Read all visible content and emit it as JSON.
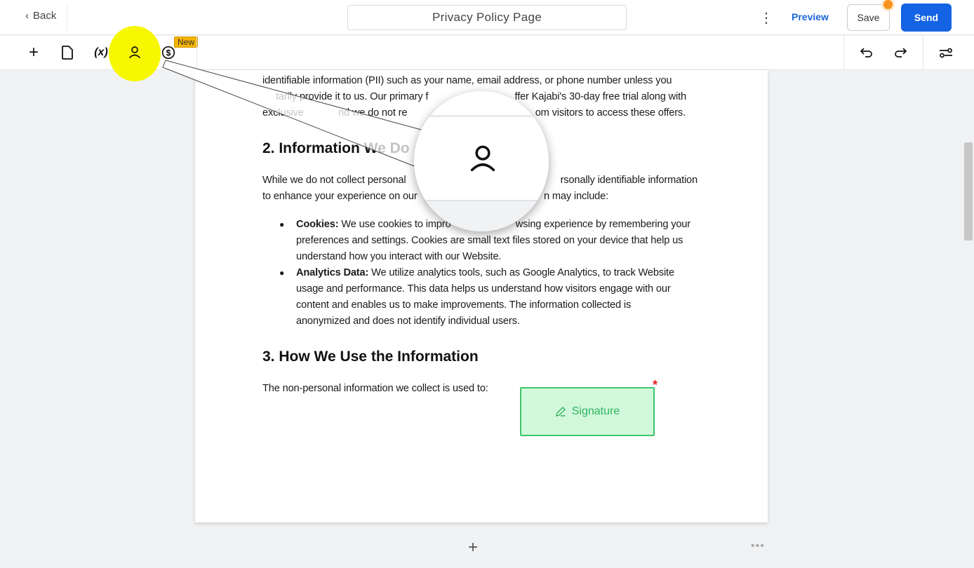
{
  "header": {
    "back_label": "Back",
    "title": "Privacy Policy Page",
    "preview_label": "Preview",
    "save_label": "Save",
    "send_label": "Send"
  },
  "toolbar": {
    "new_badge": "New",
    "tools": [
      "add-icon",
      "document-icon",
      "variable-icon",
      "person-icon",
      "dollar-icon"
    ],
    "highlight_color": "#f7f700"
  },
  "colors": {
    "accent": "#1463e4",
    "signature_border": "#3dc56b",
    "signature_fill": "#d2f8dc"
  },
  "document": {
    "p1": {
      "l1": "identifiable information (PII) such as your name, email address, or phone number unless you",
      "l2a": "tarily provide it to us. Our primary f",
      "l2b": "ffer Kajabi's 30-day free trial along with",
      "l3a": "exclusive",
      "l3b": "nd we do not re",
      "l3c": "om visitors to access these offers."
    },
    "h2": "2. Information We Do",
    "p2": {
      "l1a": "While we do not collect personal",
      "l1b": "rsonally identifiable information",
      "l2a": "to enhance your experience on our",
      "l2b": "n may include:"
    },
    "bullets": [
      {
        "term": "Cookies:",
        "l1a": "We use cookies to impro",
        "l1b": "wsing experience by remembering your",
        "l2": "preferences and settings. Cookies are small text files stored on your device that help us",
        "l3": "understand how you interact with our Website."
      },
      {
        "term": "Analytics Data:",
        "l1": "We utilize analytics tools, such as Google Analytics, to track Website",
        "l2": "usage and performance. This data helps us understand how visitors engage with our",
        "l3": "content and enables us to make improvements. The information collected is",
        "l4": "anonymized and does not identify individual users."
      }
    ],
    "h3": "3. How We Use the Information",
    "p3": "The non-personal information we collect is used to:",
    "signature_label": "Signature",
    "required_mark": "*"
  }
}
